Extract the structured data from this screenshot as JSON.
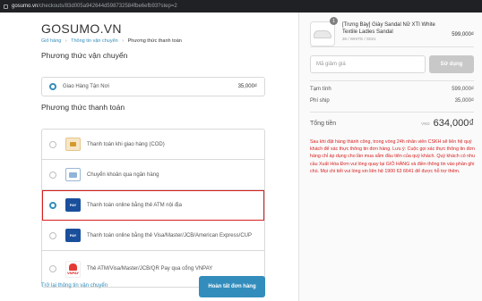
{
  "browser": {
    "domain": "gosumo.vn",
    "path": "/checkouts/83d005a942644d598732584fbe6efb93?step=2"
  },
  "brand": "GOSUMO.VN",
  "breadcrumb": {
    "items": [
      "Giỏ hàng",
      "Thông tin vận chuyển"
    ],
    "current": "Phương thức thanh toán",
    "separator": "›"
  },
  "shipping": {
    "title": "Phương thức vận chuyển",
    "option_label": "Giao Hàng Tận Nơi",
    "option_price": "35,000₫"
  },
  "payment": {
    "title": "Phương thức thanh toán",
    "options": [
      {
        "label": "Thanh toán khi giao hàng (COD)",
        "icon": "cod-icon"
      },
      {
        "label": "Chuyển khoản qua ngân hàng",
        "icon": "bank-transfer-icon"
      },
      {
        "label": "Thanh toán online bằng thẻ ATM nội địa",
        "icon": "atm-card-icon",
        "icon_text": "PAY"
      },
      {
        "label": "Thanh toán online bằng thẻ Visa/Master/JCB/American Express/CUP",
        "icon": "credit-card-icon",
        "icon_text": "PAY"
      },
      {
        "label": "Thẻ ATM/Visa/Master/JCB/QR Pay qua cổng VNPAY",
        "icon": "vnpay-icon",
        "icon_text": "VNPAY"
      }
    ],
    "selected_index": 2
  },
  "footer": {
    "back_link": "Trở lại thông tin vận chuyển",
    "complete_button": "Hoàn tất đơn hàng"
  },
  "summary": {
    "product": {
      "quantity": "1",
      "name": "[Trưng Bày] Giày Sandal Nữ XTI White Textile Ladies Sandal",
      "variant": "36 / WHITE / S021",
      "price": "599,000₫"
    },
    "discount": {
      "placeholder": "Mã giảm giá",
      "button": "Sử dụng"
    },
    "subtotal_label": "Tạm tính",
    "subtotal_value": "599,000₫",
    "shipping_label": "Phí ship",
    "shipping_value": "35,000₫",
    "total_label": "Tổng tiền",
    "currency": "VND",
    "total_value": "634,000₫",
    "notice": "Sau khi đặt hàng thành công, trong vòng 24h nhân viên CSKH sẽ liên hệ quý khách để xác thực thông tin đơn hàng. Lưu ý: Cuộc gọi xác thực thông tin đơn hàng chỉ áp dụng cho lần mua sắm đầu tiên của quý khách. Quý khách có nhu cầu Xuất Hóa Đơn vui lòng quay lại GIỎ HÀNG và điền thông tin vào phần ghi chú. Mọi chi tiết vui lòng xin liên hệ 1900 63 6641 để được hỗ trợ thêm."
  },
  "colors": {
    "accent": "#338dbc",
    "highlight_border": "#d81e1e",
    "notice_text": "#d81e1e"
  }
}
